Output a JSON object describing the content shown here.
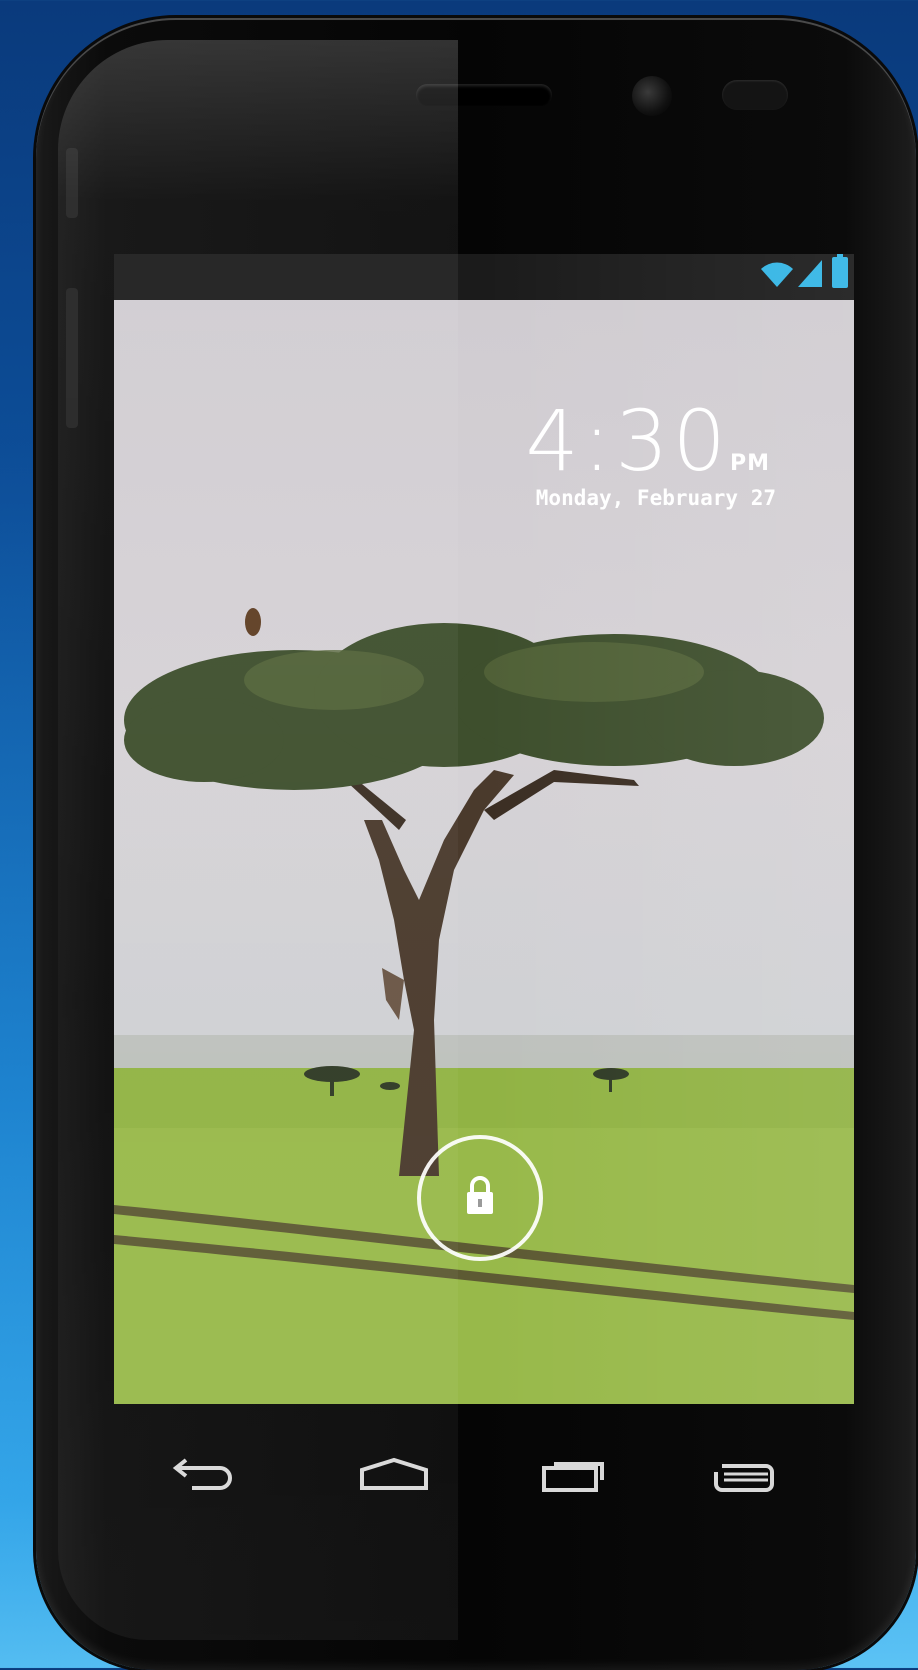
{
  "lockscreen": {
    "time": "4:30",
    "ampm": "PM",
    "date": "Monday, February 27"
  },
  "status_bar": {
    "icons": [
      "wifi-icon",
      "signal-icon",
      "battery-icon"
    ],
    "icon_color": "#33b5e5"
  },
  "navigation": {
    "keys": [
      "back-icon",
      "home-icon",
      "recent-apps-icon",
      "menu-icon"
    ]
  },
  "colors": {
    "background": "#0d4f9a",
    "phone_body": "#050505",
    "status_bar": "#1b1b1b",
    "text": "#ffffff"
  }
}
